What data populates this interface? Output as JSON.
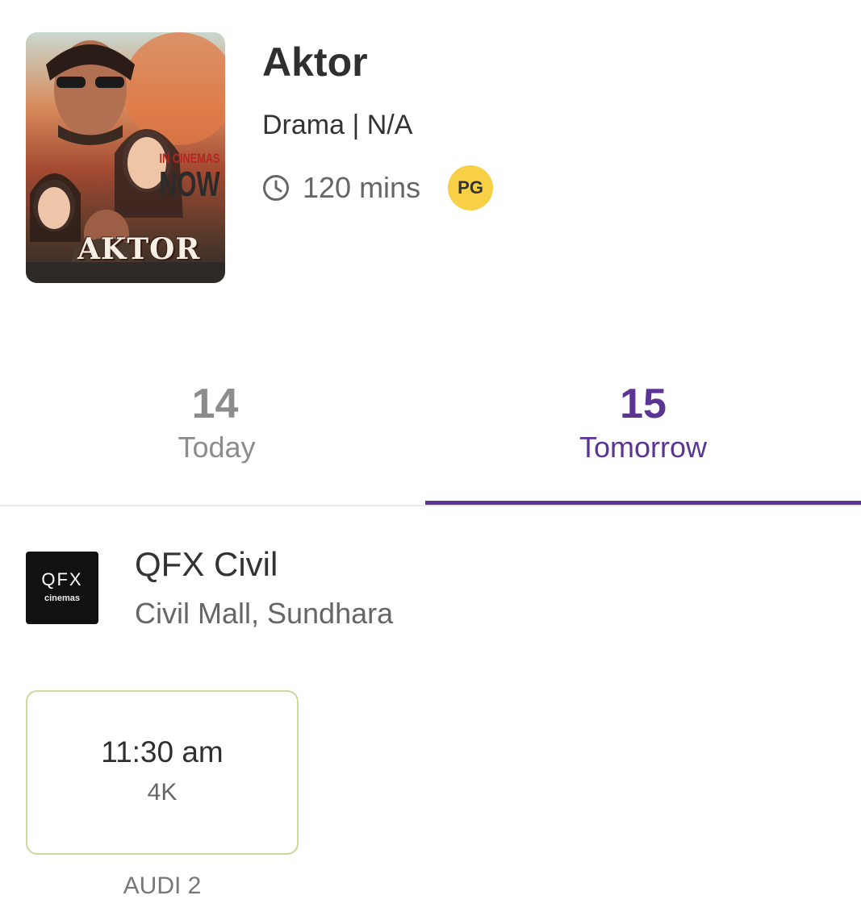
{
  "movie": {
    "title": "Aktor",
    "meta": "Drama | N/A",
    "duration": "120 mins",
    "rating": "PG",
    "duration_icon": "clock-icon",
    "poster": {
      "tagline_line1": "IN CINEMAS",
      "tagline_line2": "NOW",
      "title": "AKTOR"
    }
  },
  "date_tabs": [
    {
      "day": "14",
      "label": "Today",
      "selected": false
    },
    {
      "day": "15",
      "label": "Tomorrow",
      "selected": true
    }
  ],
  "cinema": {
    "logo_brand": "QFX",
    "logo_sub": "cinemas",
    "name": "QFX Civil",
    "location": "Civil Mall, Sundhara"
  },
  "showtimes": [
    {
      "time": "11:30 am",
      "format": "4K",
      "hall": "AUDI 2"
    }
  ],
  "colors": {
    "accent": "#5b3593",
    "rating_badge": "#f7d046",
    "showtime_border": "#c5dc9c"
  }
}
